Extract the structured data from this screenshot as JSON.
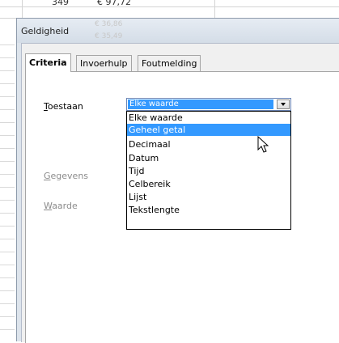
{
  "spreadsheet": {
    "cells": [
      "349",
      "€ 97,72"
    ],
    "ghost_values": [
      "€ 36,86",
      "€ 35,49"
    ]
  },
  "dialog": {
    "title": "Geldigheid",
    "tabs": [
      {
        "label": "Criteria",
        "active": true
      },
      {
        "label": "Invoerhulp",
        "active": false
      },
      {
        "label": "Foutmelding",
        "active": false
      }
    ],
    "fields": {
      "toestaan": {
        "label": "Toestaan",
        "accel": "T",
        "rest": "oestaan",
        "value": "Elke waarde"
      },
      "gegevens": {
        "label": "Gegevens",
        "accel": "G",
        "rest": "egevens"
      },
      "waarde": {
        "label": "Waarde",
        "accel": "W",
        "rest": "aarde"
      }
    },
    "dropdown": {
      "options": [
        "Elke waarde",
        "Geheel getal",
        "Decimaal",
        "Datum",
        "Tijd",
        "Celbereik",
        "Lijst",
        "Tekstlengte"
      ],
      "highlighted": "Geheel getal"
    }
  },
  "colors": {
    "selection": "#3399ff",
    "dialog_frame": "#dde4ec",
    "grid": "#d4d4d4"
  },
  "icons": {
    "cursor": "mouse-pointer-icon",
    "dropdown_button": "chevron-down-icon"
  }
}
